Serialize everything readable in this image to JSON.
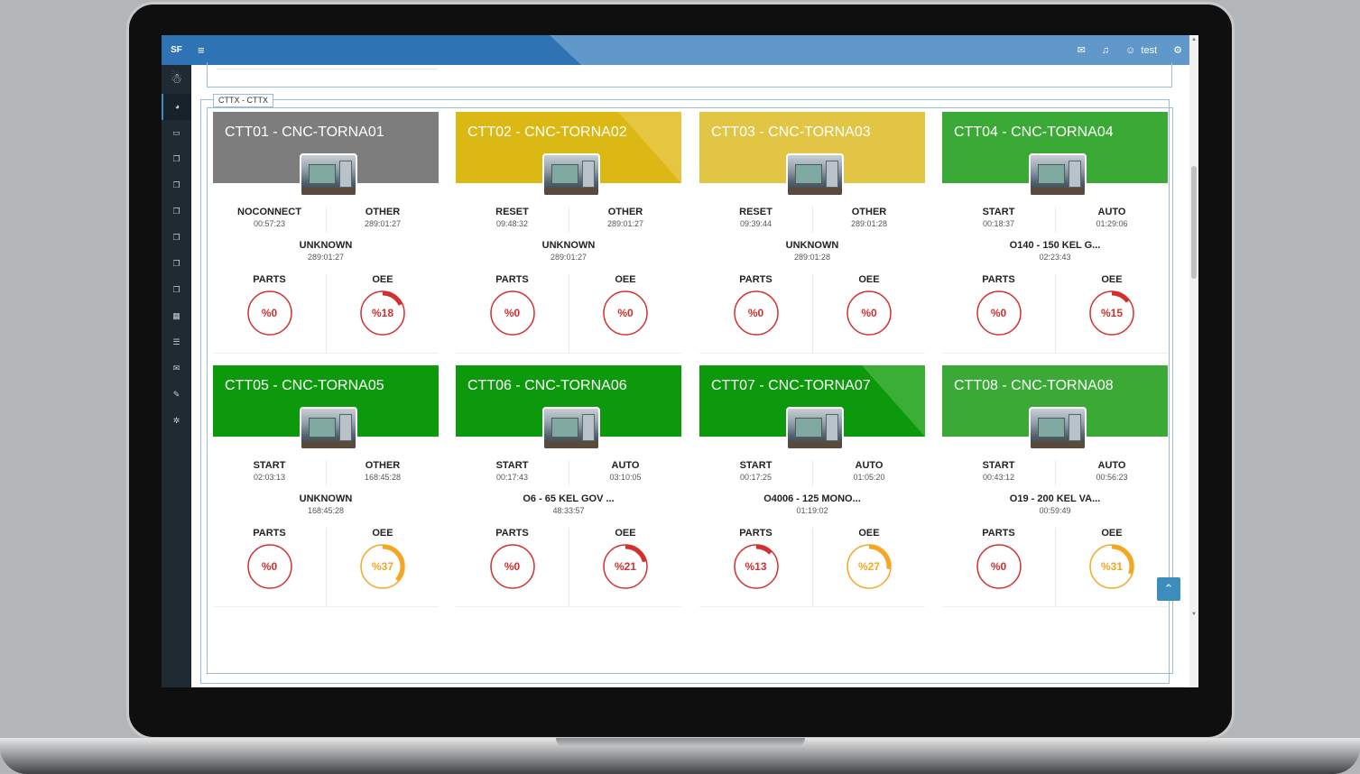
{
  "app": {
    "brand": "SF",
    "user": "test"
  },
  "topbar": {
    "menu_icon": "hamburger-icon",
    "mail_icon": "mail-icon",
    "bell_icon": "bell-icon",
    "user_icon": "user-icon",
    "settings_icon": "gears-icon"
  },
  "sidebar": {
    "items": [
      {
        "icon": "dashboard-icon",
        "glyph": "◕",
        "active": true
      },
      {
        "icon": "monitor-icon",
        "glyph": "▭"
      },
      {
        "icon": "copy-icon",
        "glyph": "❐"
      },
      {
        "icon": "copy-icon",
        "glyph": "❐"
      },
      {
        "icon": "copy-icon",
        "glyph": "❐"
      },
      {
        "icon": "copy-icon",
        "glyph": "❐"
      },
      {
        "icon": "copy-icon",
        "glyph": "❐"
      },
      {
        "icon": "copy-icon",
        "glyph": "❐"
      },
      {
        "icon": "calendar-icon",
        "glyph": "▦"
      },
      {
        "icon": "list-icon",
        "glyph": "☰"
      },
      {
        "icon": "envelope-icon",
        "glyph": "✉"
      },
      {
        "icon": "pencil-icon",
        "glyph": "✎"
      },
      {
        "icon": "gear-icon",
        "glyph": "✲"
      }
    ]
  },
  "group": {
    "label": "CTTX - CTTX"
  },
  "colors": {
    "gray": "#7d7d7d",
    "yellow_dark": "#dcb815",
    "yellow_light": "#e2c544",
    "green": "#3aa935",
    "green_dark": "#0c9a0c",
    "gauge_red": "#d32f2f",
    "gauge_orange": "#f5a623"
  },
  "cards": [
    {
      "title": "CTT01 - CNC-TORNA01",
      "color": "#7d7d7d",
      "accent": "",
      "s1": "NOCONNECT",
      "t1": "00:57:23",
      "s2": "OTHER",
      "t2": "289:01:27",
      "prog": "UNKNOWN",
      "pt": "289:01:27",
      "parts_label": "PARTS",
      "oee_label": "OEE",
      "parts": "%0",
      "parts_value": 0,
      "oee": "%18",
      "oee_value": 18,
      "oee_color": "#d32f2f",
      "parts_color": "#d32f2f"
    },
    {
      "title": "CTT02 - CNC-TORNA02",
      "color": "#dcb815",
      "accent": "#e6c640",
      "s1": "RESET",
      "t1": "09:48:32",
      "s2": "OTHER",
      "t2": "289:01:27",
      "prog": "UNKNOWN",
      "pt": "289:01:27",
      "parts_label": "PARTS",
      "oee_label": "OEE",
      "parts": "%0",
      "parts_value": 0,
      "oee": "%0",
      "oee_value": 0,
      "oee_color": "#d32f2f",
      "parts_color": "#d32f2f"
    },
    {
      "title": "CTT03 - CNC-TORNA03",
      "color": "#e2c544",
      "accent": "",
      "s1": "RESET",
      "t1": "09:39:44",
      "s2": "OTHER",
      "t2": "289:01:28",
      "prog": "UNKNOWN",
      "pt": "289:01:28",
      "parts_label": "PARTS",
      "oee_label": "OEE",
      "parts": "%0",
      "parts_value": 0,
      "oee": "%0",
      "oee_value": 0,
      "oee_color": "#d32f2f",
      "parts_color": "#d32f2f"
    },
    {
      "title": "CTT04 - CNC-TORNA04",
      "color": "#3aa935",
      "accent": "",
      "s1": "START",
      "t1": "00:18:37",
      "s2": "AUTO",
      "t2": "01:29:06",
      "prog": "O140 - 150 KEL G...",
      "pt": "02:23:43",
      "parts_label": "PARTS",
      "oee_label": "OEE",
      "parts": "%0",
      "parts_value": 0,
      "oee": "%15",
      "oee_value": 15,
      "oee_color": "#d32f2f",
      "parts_color": "#d32f2f"
    },
    {
      "title": "CTT05 - CNC-TORNA05",
      "color": "#0c9a0c",
      "accent": "",
      "s1": "START",
      "t1": "02:03:13",
      "s2": "OTHER",
      "t2": "168:45:28",
      "prog": "UNKNOWN",
      "pt": "168:45:28",
      "parts_label": "PARTS",
      "oee_label": "OEE",
      "parts": "%0",
      "parts_value": 0,
      "oee": "%37",
      "oee_value": 37,
      "oee_color": "#f5a623",
      "parts_color": "#d32f2f"
    },
    {
      "title": "CTT06 - CNC-TORNA06",
      "color": "#0c9a0c",
      "accent": "",
      "s1": "START",
      "t1": "00:17:43",
      "s2": "AUTO",
      "t2": "03:10:05",
      "prog": "O6 - 65 KEL GOV ...",
      "pt": "48:33:57",
      "parts_label": "PARTS",
      "oee_label": "OEE",
      "parts": "%0",
      "parts_value": 0,
      "oee": "%21",
      "oee_value": 21,
      "oee_color": "#d32f2f",
      "parts_color": "#d32f2f"
    },
    {
      "title": "CTT07 - CNC-TORNA07",
      "color": "#0c9a0c",
      "accent": "#3aae35",
      "s1": "START",
      "t1": "00:17:25",
      "s2": "AUTO",
      "t2": "01:05:20",
      "prog": "O4006 - 125 MONO...",
      "pt": "01:19:02",
      "parts_label": "PARTS",
      "oee_label": "OEE",
      "parts": "%13",
      "parts_value": 13,
      "oee": "%27",
      "oee_value": 27,
      "oee_color": "#f5a623",
      "parts_color": "#d32f2f"
    },
    {
      "title": "CTT08 - CNC-TORNA08",
      "color": "#3aa935",
      "accent": "",
      "s1": "START",
      "t1": "00:43:12",
      "s2": "AUTO",
      "t2": "00:56:23",
      "prog": "O19 - 200 KEL VA...",
      "pt": "00:59:49",
      "parts_label": "PARTS",
      "oee_label": "OEE",
      "parts": "%0",
      "parts_value": 0,
      "oee": "%31",
      "oee_value": 31,
      "oee_color": "#f5a623",
      "parts_color": "#d32f2f"
    }
  ]
}
